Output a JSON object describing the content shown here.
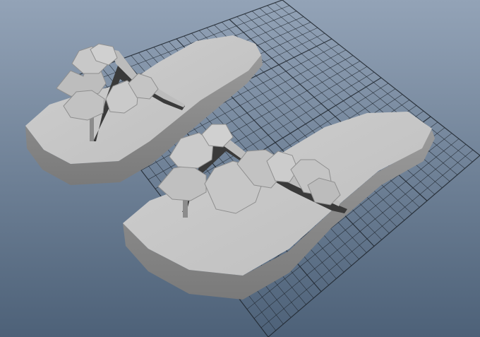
{
  "viewport": {
    "colors": {
      "background_top": "#93a3b7",
      "background_bottom": "#4d6178",
      "grid_line": "#1f262e",
      "model_light": "#c9c9c9",
      "model_mid": "#a9a9a9",
      "model_dark": "#808080",
      "model_shadow": "#3a3a3a"
    }
  },
  "scene": {
    "objects": [
      {
        "kind": "grid",
        "icon": "ground-grid-icon"
      },
      {
        "kind": "mesh",
        "icon": "flip-flop-sandal-icon",
        "side": "left"
      },
      {
        "kind": "mesh",
        "icon": "flip-flop-sandal-icon",
        "side": "right"
      }
    ]
  }
}
